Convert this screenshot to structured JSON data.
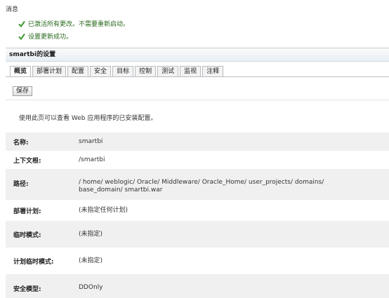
{
  "messages": {
    "title": "消息",
    "items": [
      "已激活所有更改。不需要重新启动。",
      "设置更新成功。"
    ]
  },
  "panel": {
    "title": "smartbi的设置",
    "tabs": [
      "概览",
      "部署计划",
      "配置",
      "安全",
      "目标",
      "控制",
      "测试",
      "监视",
      "注释"
    ],
    "active_tab": 0,
    "save_label": "保存",
    "description": "使用此页可以查看 Web 应用程序的已安装配置。",
    "properties": [
      {
        "label": "名称:",
        "value": "smartbi"
      },
      {
        "label": "上下文根:",
        "value": "/smartbi"
      },
      {
        "label": "路径:",
        "value": "/ home/ weblogic/ Oracle/ Middleware/ Oracle_Home/ user_projects/ domains/ base_domain/ smartbi.war"
      },
      {
        "label": "部署计划:",
        "value": "(未指定任何计划)"
      },
      {
        "label": "临时模式:",
        "value": "(未指定)"
      },
      {
        "label": "计划临时模式:",
        "value": "(未指定)"
      },
      {
        "label": "安全模型:",
        "value": "DDOnly"
      }
    ]
  },
  "colors": {
    "success_text": "#2a6a1e",
    "success_check": "#3a9a2a",
    "row_alt": "#f0f0f0"
  }
}
